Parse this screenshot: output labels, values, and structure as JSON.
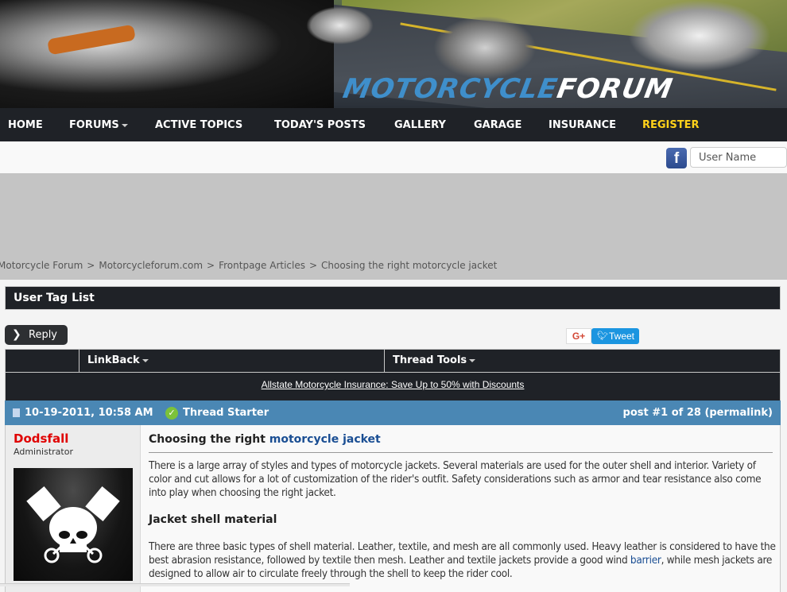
{
  "banner": {
    "logo_part1": "MOTORCYCLE",
    "logo_part2": "FORUM"
  },
  "nav": {
    "items": [
      {
        "label": "HOME"
      },
      {
        "label": "FORUMS",
        "has_dropdown": true
      },
      {
        "label": "ACTIVE TOPICS"
      },
      {
        "label": "TODAY'S POSTS"
      },
      {
        "label": "GALLERY"
      },
      {
        "label": "GARAGE"
      },
      {
        "label": "INSURANCE"
      },
      {
        "label": "REGISTER",
        "color": "#ffd21a"
      }
    ]
  },
  "login": {
    "facebook_icon": "f",
    "username_placeholder": "User Name"
  },
  "breadcrumb": {
    "items": [
      "Motorcycle Forum",
      "Motorcycleforum.com",
      "Frontpage Articles",
      "Choosing the right motorcycle jacket"
    ],
    "separator": ">"
  },
  "tag_list": {
    "title": "User Tag List"
  },
  "actions": {
    "reply_label": "Reply",
    "gplus_label": "G+",
    "tweet_label": "Tweet"
  },
  "tools": {
    "linkback_label": "LinkBack",
    "thread_tools_label": "Thread Tools"
  },
  "ad": {
    "text": "Allstate Motorcycle Insurance: Save Up to 50% with Discounts"
  },
  "post": {
    "date": "10-19-2011, 10:58 AM",
    "starter_label": "Thread Starter",
    "post_number": "post #1 of 28 (permalink)",
    "author": {
      "name": "Dodsfall",
      "role": "Administrator",
      "name_color": "#e00000"
    },
    "title_prefix": "Choosing the right ",
    "title_link": "motorcycle jacket",
    "paragraph1": "There is a large array of styles and types of motorcycle jackets. Several materials are used for the outer shell and interior. Variety of color and cut allows for a lot of customization of the rider's outfit. Safety considerations such as armor and tear resistance also come into play when choosing the right jacket.",
    "heading2": "Jacket shell material",
    "paragraph2_before_link": "There are three basic types of shell material. Leather, textile, and mesh are all commonly used. Heavy leather is considered to have the best abrasion resistance, followed by textile then mesh. Leather and textile jackets provide a good wind ",
    "paragraph2_link": "barrier",
    "paragraph2_after_link": ", while mesh jackets are designed to allow air to circulate freely through the shell to keep the rider cool."
  },
  "colors": {
    "nav_bg": "#1f2227",
    "post_header_bg": "#4a87b4",
    "link": "#1a4e93",
    "register": "#ffd21a"
  }
}
